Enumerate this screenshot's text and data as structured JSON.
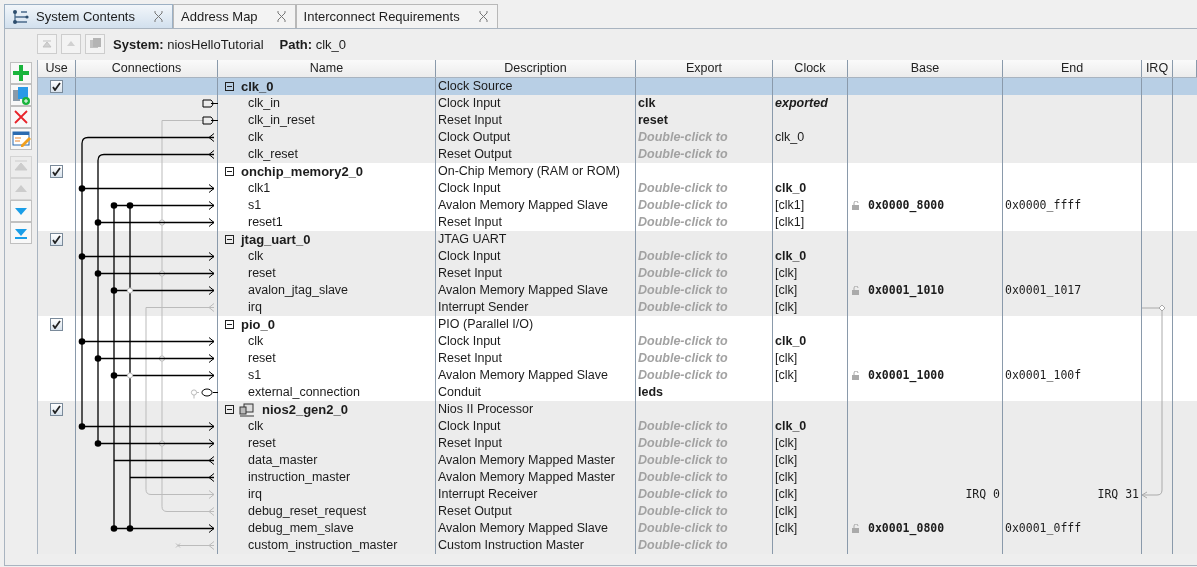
{
  "tabs": [
    {
      "label": "System Contents",
      "selected": true,
      "kind": "system"
    },
    {
      "label": "Address Map",
      "selected": false
    },
    {
      "label": "Interconnect Requirements",
      "selected": false
    }
  ],
  "nav_buttons": [
    {
      "kind": "top",
      "disabled": true
    },
    {
      "kind": "up",
      "disabled": true
    },
    {
      "kind": "hierarchy",
      "disabled": true
    }
  ],
  "breadcrumb": {
    "system": "**System:** niosHelloTutorial",
    "path": "**Path:** clk_0"
  },
  "side_toolbar": [
    {
      "kind": "add",
      "disabled": false
    },
    {
      "kind": "add-system",
      "disabled": false
    },
    {
      "kind": "remove",
      "disabled": false
    },
    {
      "kind": "edit",
      "disabled": false
    },
    {
      "kind": "move-top",
      "disabled": true
    },
    {
      "kind": "move-up",
      "disabled": true
    },
    {
      "kind": "move-down",
      "disabled": false
    },
    {
      "kind": "move-bottom",
      "disabled": false
    }
  ],
  "table": {
    "columns": [
      "Use",
      "Connections",
      "Name",
      "Description",
      "Export",
      "Clock",
      "Base",
      "End",
      "IRQ"
    ],
    "components": [
      {
        "name": "clk_0",
        "description": "Clock Source",
        "use": true,
        "selected": true,
        "expanded": true,
        "kind": "module",
        "interfaces": [
          {
            "name": "clk_in",
            "description": "Clock Input",
            "export": "clk",
            "export_hint": false,
            "clock": {
              "text": "exported",
              "kind": "bold-italic"
            }
          },
          {
            "name": "clk_in_reset",
            "description": "Reset Input",
            "export": "reset",
            "export_hint": false
          },
          {
            "name": "clk",
            "description": "Clock Output",
            "export": "Double-click to",
            "export_hint": true,
            "clock": {
              "text": "clk_0",
              "kind": "plain"
            }
          },
          {
            "name": "clk_reset",
            "description": "Reset Output",
            "export": "Double-click to",
            "export_hint": true
          }
        ]
      },
      {
        "name": "onchip_memory2_0",
        "description": "On-Chip Memory (RAM or ROM)",
        "use": true,
        "selected": false,
        "expanded": true,
        "kind": "module",
        "interfaces": [
          {
            "name": "clk1",
            "description": "Clock Input",
            "export": "Double-click to",
            "export_hint": true,
            "clock": {
              "text": "clk_0",
              "kind": "bold"
            }
          },
          {
            "name": "s1",
            "description": "Avalon Memory Mapped Slave",
            "export": "Double-click to",
            "export_hint": true,
            "clock": {
              "text": "[clk1]",
              "kind": "plain"
            },
            "address": {
              "kind": "range",
              "base": "0x0000_8000",
              "end": "0x0000_ffff"
            }
          },
          {
            "name": "reset1",
            "description": "Reset Input",
            "export": "Double-click to",
            "export_hint": true,
            "clock": {
              "text": "[clk1]",
              "kind": "plain"
            }
          }
        ]
      },
      {
        "name": "jtag_uart_0",
        "description": "JTAG UART",
        "use": true,
        "selected": false,
        "expanded": true,
        "kind": "module",
        "interfaces": [
          {
            "name": "clk",
            "description": "Clock Input",
            "export": "Double-click to",
            "export_hint": true,
            "clock": {
              "text": "clk_0",
              "kind": "bold"
            }
          },
          {
            "name": "reset",
            "description": "Reset Input",
            "export": "Double-click to",
            "export_hint": true,
            "clock": {
              "text": "[clk]",
              "kind": "plain"
            }
          },
          {
            "name": "avalon_jtag_slave",
            "description": "Avalon Memory Mapped Slave",
            "export": "Double-click to",
            "export_hint": true,
            "clock": {
              "text": "[clk]",
              "kind": "plain"
            },
            "address": {
              "kind": "range",
              "base": "0x0001_1010",
              "end": "0x0001_1017"
            }
          },
          {
            "name": "irq",
            "description": "Interrupt Sender",
            "export": "Double-click to",
            "export_hint": true,
            "clock": {
              "text": "[clk]",
              "kind": "plain"
            }
          }
        ]
      },
      {
        "name": "pio_0",
        "description": "PIO (Parallel I/O)",
        "use": true,
        "selected": false,
        "expanded": true,
        "kind": "module",
        "interfaces": [
          {
            "name": "clk",
            "description": "Clock Input",
            "export": "Double-click to",
            "export_hint": true,
            "clock": {
              "text": "clk_0",
              "kind": "bold"
            }
          },
          {
            "name": "reset",
            "description": "Reset Input",
            "export": "Double-click to",
            "export_hint": true,
            "clock": {
              "text": "[clk]",
              "kind": "plain"
            }
          },
          {
            "name": "s1",
            "description": "Avalon Memory Mapped Slave",
            "export": "Double-click to",
            "export_hint": true,
            "clock": {
              "text": "[clk]",
              "kind": "plain"
            },
            "address": {
              "kind": "range",
              "base": "0x0001_1000",
              "end": "0x0001_100f"
            }
          },
          {
            "name": "external_connection",
            "description": "Conduit",
            "export": "leds",
            "export_hint": false
          }
        ]
      },
      {
        "name": "nios2_gen2_0",
        "description": "Nios II Processor",
        "use": true,
        "selected": false,
        "expanded": true,
        "kind": "processor",
        "interfaces": [
          {
            "name": "clk",
            "description": "Clock Input",
            "export": "Double-click to",
            "export_hint": true,
            "clock": {
              "text": "clk_0",
              "kind": "bold"
            }
          },
          {
            "name": "reset",
            "description": "Reset Input",
            "export": "Double-click to",
            "export_hint": true,
            "clock": {
              "text": "[clk]",
              "kind": "plain"
            }
          },
          {
            "name": "data_master",
            "description": "Avalon Memory Mapped Master",
            "export": "Double-click to",
            "export_hint": true,
            "clock": {
              "text": "[clk]",
              "kind": "plain"
            }
          },
          {
            "name": "instruction_master",
            "description": "Avalon Memory Mapped Master",
            "export": "Double-click to",
            "export_hint": true,
            "clock": {
              "text": "[clk]",
              "kind": "plain"
            }
          },
          {
            "name": "irq",
            "description": "Interrupt Receiver",
            "export": "Double-click to",
            "export_hint": true,
            "clock": {
              "text": "[clk]",
              "kind": "plain"
            },
            "address": {
              "kind": "irq",
              "base": "IRQ 0",
              "end": "IRQ 31"
            }
          },
          {
            "name": "debug_reset_request",
            "description": "Reset Output",
            "export": "Double-click to",
            "export_hint": true,
            "clock": {
              "text": "[clk]",
              "kind": "plain"
            }
          },
          {
            "name": "debug_mem_slave",
            "description": "Avalon Memory Mapped Slave",
            "export": "Double-click to",
            "export_hint": true,
            "clock": {
              "text": "[clk]",
              "kind": "plain"
            },
            "address": {
              "kind": "range",
              "base": "0x0001_0800",
              "end": "0x0001_0fff"
            }
          },
          {
            "name": "custom_instruction_master",
            "description": "Custom Instruction Master",
            "export": "Double-click to",
            "export_hint": true
          }
        ]
      }
    ]
  }
}
